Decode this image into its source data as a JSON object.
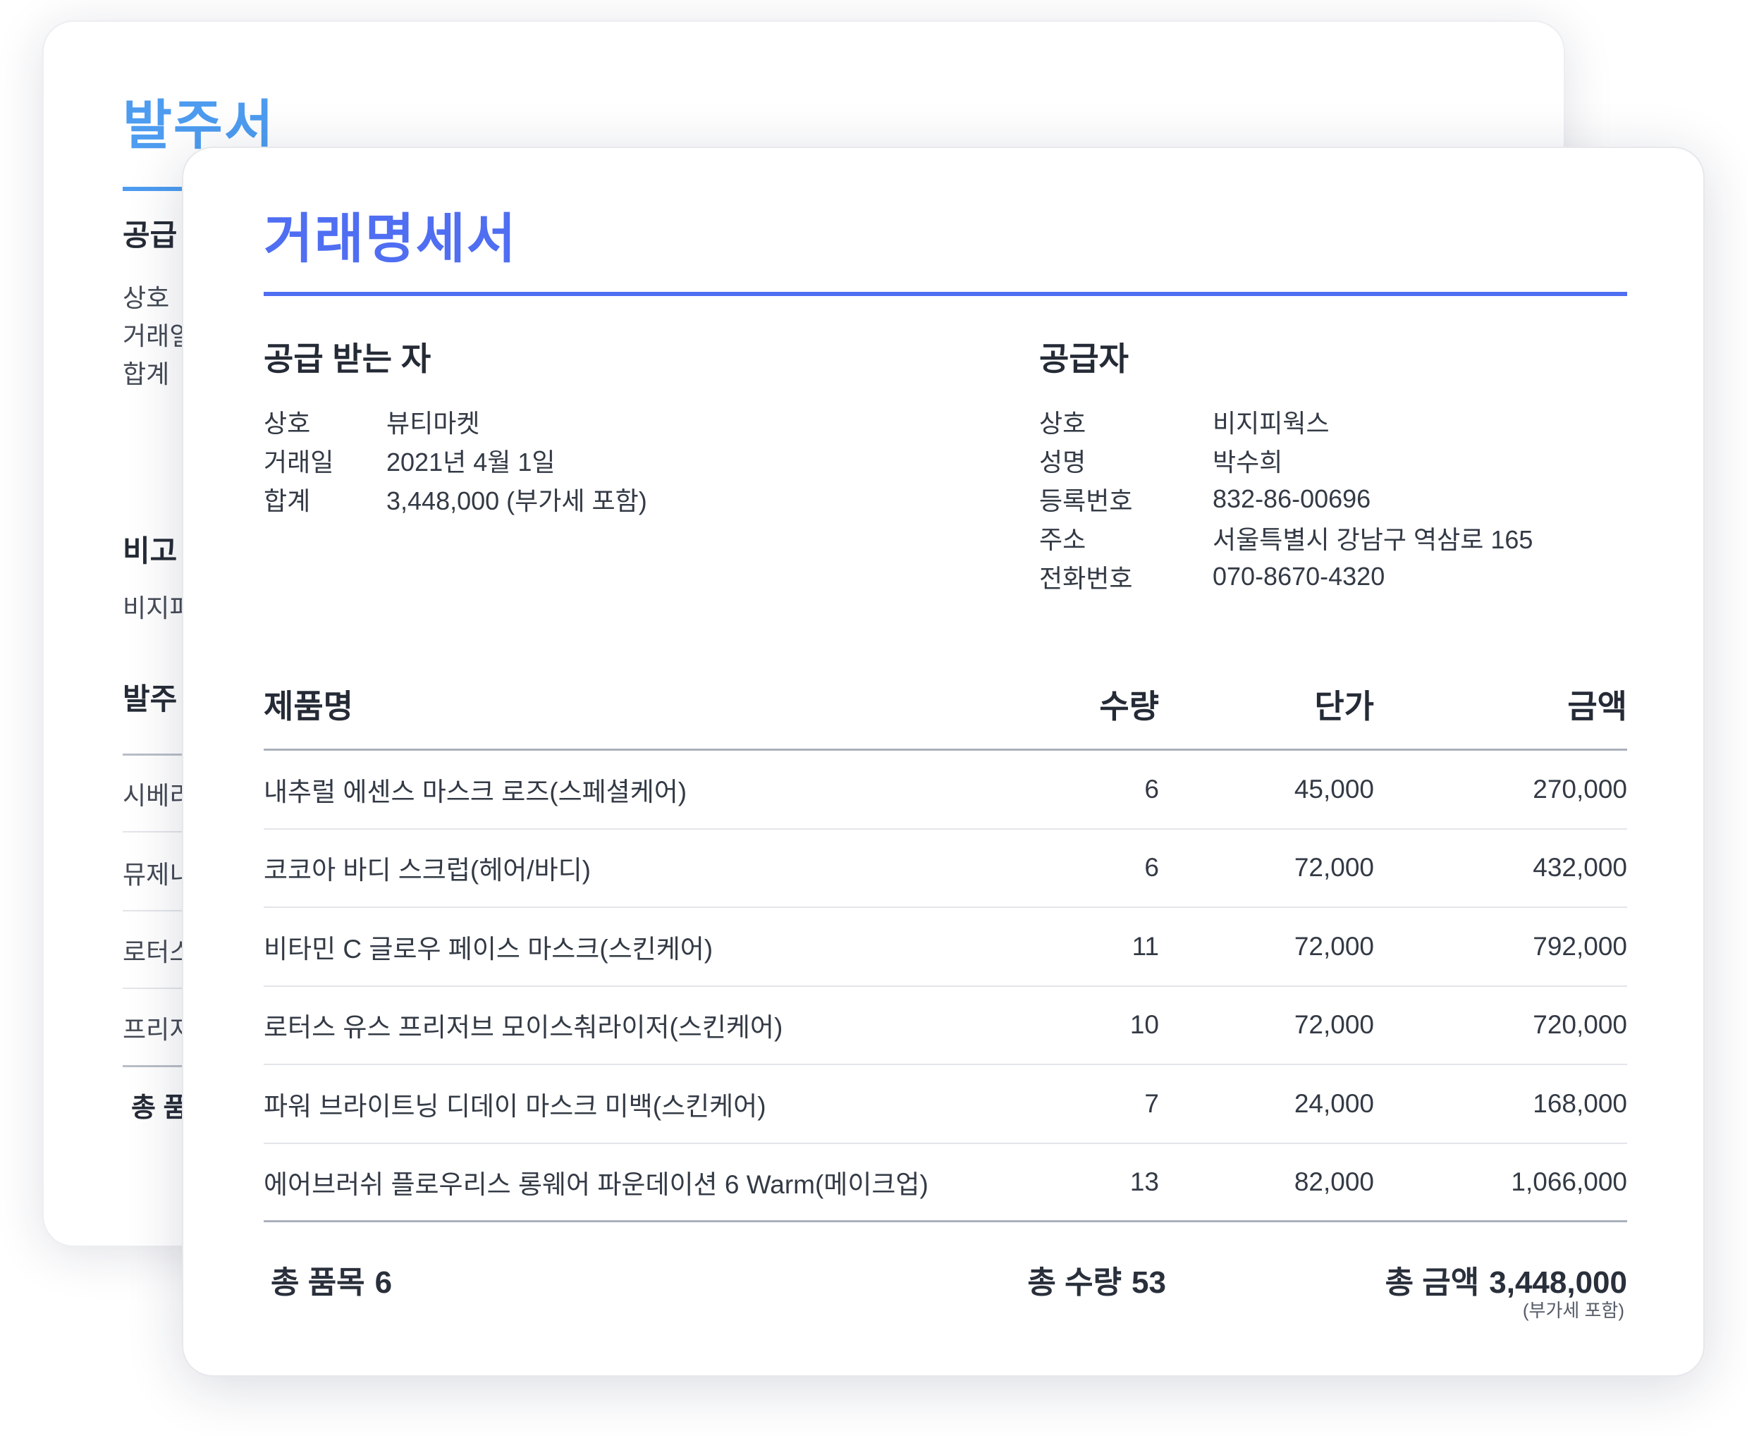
{
  "back_doc": {
    "title": "발주서",
    "section_supplier": "공급",
    "labels": [
      "상호",
      "거래일",
      "합계"
    ],
    "section_note": "비고",
    "note_text": "비지피",
    "section_order": "발주",
    "items": [
      "시베리",
      "뮤제니",
      "로터스",
      "프리지"
    ],
    "total_label": "총 품"
  },
  "statement": {
    "title": "거래명세서",
    "receiver": {
      "heading": "공급 받는 자",
      "rows": [
        {
          "label": "상호",
          "value": "뷰티마켓"
        },
        {
          "label": "거래일",
          "value": "2021년 4월 1일"
        },
        {
          "label": "합계",
          "value": "3,448,000 (부가세 포함)"
        }
      ]
    },
    "supplier": {
      "heading": "공급자",
      "rows": [
        {
          "label": "상호",
          "value": "비지피웍스"
        },
        {
          "label": "성명",
          "value": "박수희"
        },
        {
          "label": "등록번호",
          "value": "832-86-00696"
        },
        {
          "label": "주소",
          "value": "서울특별시 강남구 역삼로 165"
        },
        {
          "label": "전화번호",
          "value": "070-8670-4320"
        }
      ]
    },
    "table": {
      "headers": {
        "name": "제품명",
        "qty": "수량",
        "unit_price": "단가",
        "amount": "금액"
      },
      "rows": [
        {
          "name": "내추럴 에센스 마스크 로즈(스페셜케어)",
          "qty": "6",
          "unit_price": "45,000",
          "amount": "270,000"
        },
        {
          "name": "코코아 바디 스크럽(헤어/바디)",
          "qty": "6",
          "unit_price": "72,000",
          "amount": "432,000"
        },
        {
          "name": "비타민 C 글로우 페이스 마스크(스킨케어)",
          "qty": "11",
          "unit_price": "72,000",
          "amount": "792,000"
        },
        {
          "name": "로터스 유스 프리저브 모이스춰라이저(스킨케어)",
          "qty": "10",
          "unit_price": "72,000",
          "amount": "720,000"
        },
        {
          "name": "파워 브라이트닝 디데이 마스크 미백(스킨케어)",
          "qty": "7",
          "unit_price": "24,000",
          "amount": "168,000"
        },
        {
          "name": "에어브러쉬 플로우리스 롱웨어 파운데이션 6 Warm(메이크업)",
          "qty": "13",
          "unit_price": "82,000",
          "amount": "1,066,000"
        }
      ]
    },
    "totals": {
      "items_label": "총 품목",
      "items_value": "6",
      "qty_label": "총 수량",
      "qty_value": "53",
      "amount_label": "총 금액",
      "amount_value": "3,448,000",
      "vat_note": "(부가세 포함)"
    }
  },
  "colors": {
    "back_accent": "#4d9cf0",
    "front_accent": "#4f6ef2",
    "text": "#333a45"
  }
}
